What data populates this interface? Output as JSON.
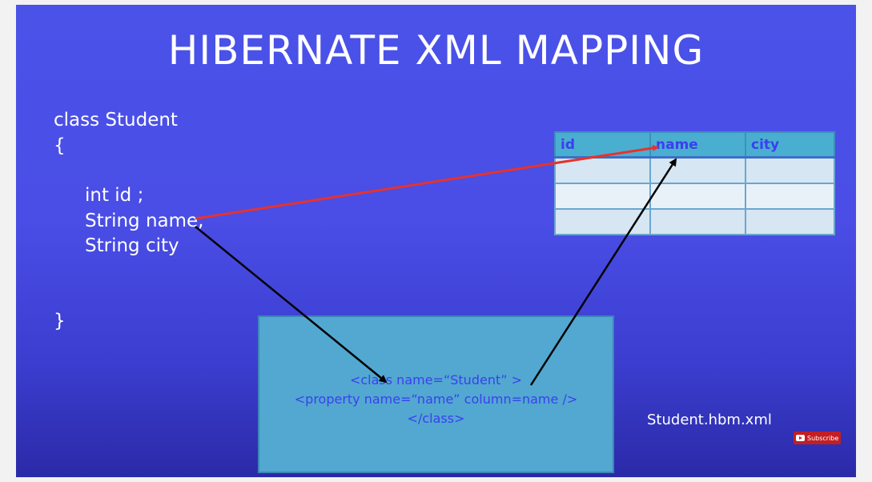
{
  "title": "HIBERNATE XML MAPPING",
  "class_code": {
    "line1": "class Student",
    "open_brace": "{",
    "field_id": "int id ;",
    "field_name": "String name;",
    "field_city": "String city",
    "close_brace": "}"
  },
  "table": {
    "columns": [
      "id",
      "name",
      "city"
    ],
    "empty_rows": 3
  },
  "xml_mapping": {
    "line1": "<class name=“Student” >",
    "line2": "<property name=“name” column=name />",
    "line3": "</class>"
  },
  "file_label": "Student.hbm.xml",
  "subscribe_label": "Subscribe",
  "colors": {
    "background": "#4a52e8",
    "mapping_arrow": "#e8322a",
    "flow_arrow": "#000000",
    "table_header": "#4aaed0",
    "xml_box": "#52a8d0",
    "xml_text": "#3b3ff0"
  }
}
